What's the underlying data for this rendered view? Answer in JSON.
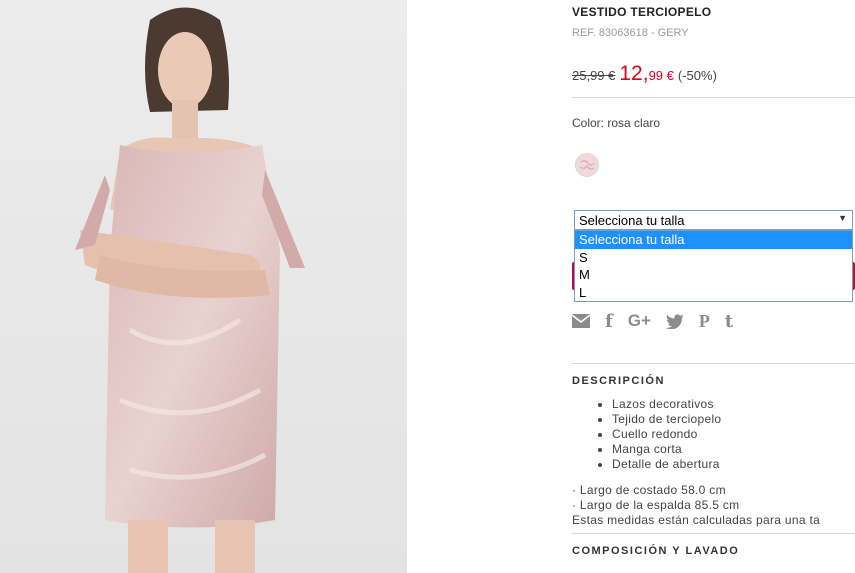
{
  "product": {
    "title": "VESTIDO TERCIOPELO",
    "ref": "REF. 83063618 - GERY",
    "old_price": "25,99 €",
    "new_price_int": "12,",
    "new_price_dec": "99 €",
    "discount": "(-50%)",
    "image_icon": "product-photo"
  },
  "color": {
    "label": "Color: rosa claro",
    "swatch_color": "#f0dade"
  },
  "size_select": {
    "value": "Selecciona tu talla",
    "options": [
      "Selecciona tu talla",
      "S",
      "M",
      "L"
    ]
  },
  "share": {
    "icons": [
      "mail-icon",
      "facebook-icon",
      "google-plus-icon",
      "twitter-icon",
      "pinterest-icon",
      "tumblr-icon"
    ],
    "facebook_glyph": "f",
    "google_glyph": "G+",
    "pinterest_glyph": "P",
    "tumblr_glyph": "t"
  },
  "description": {
    "title": "DESCRIPCIÓN",
    "items": [
      "Lazos decorativos",
      "Tejido de terciopelo",
      "Cuello redondo",
      "Manga corta",
      "Detalle de abertura"
    ],
    "measures": [
      "· Largo de costado 58.0 cm",
      "· Largo de la espalda 85.5 cm",
      "Estas medidas están calculadas para una ta"
    ]
  },
  "composition": {
    "title": "COMPOSICIÓN Y LAVADO"
  },
  "colors": {
    "accent": "#e0001b",
    "button": "#b8113e",
    "select_highlight": "#1e90ff"
  }
}
